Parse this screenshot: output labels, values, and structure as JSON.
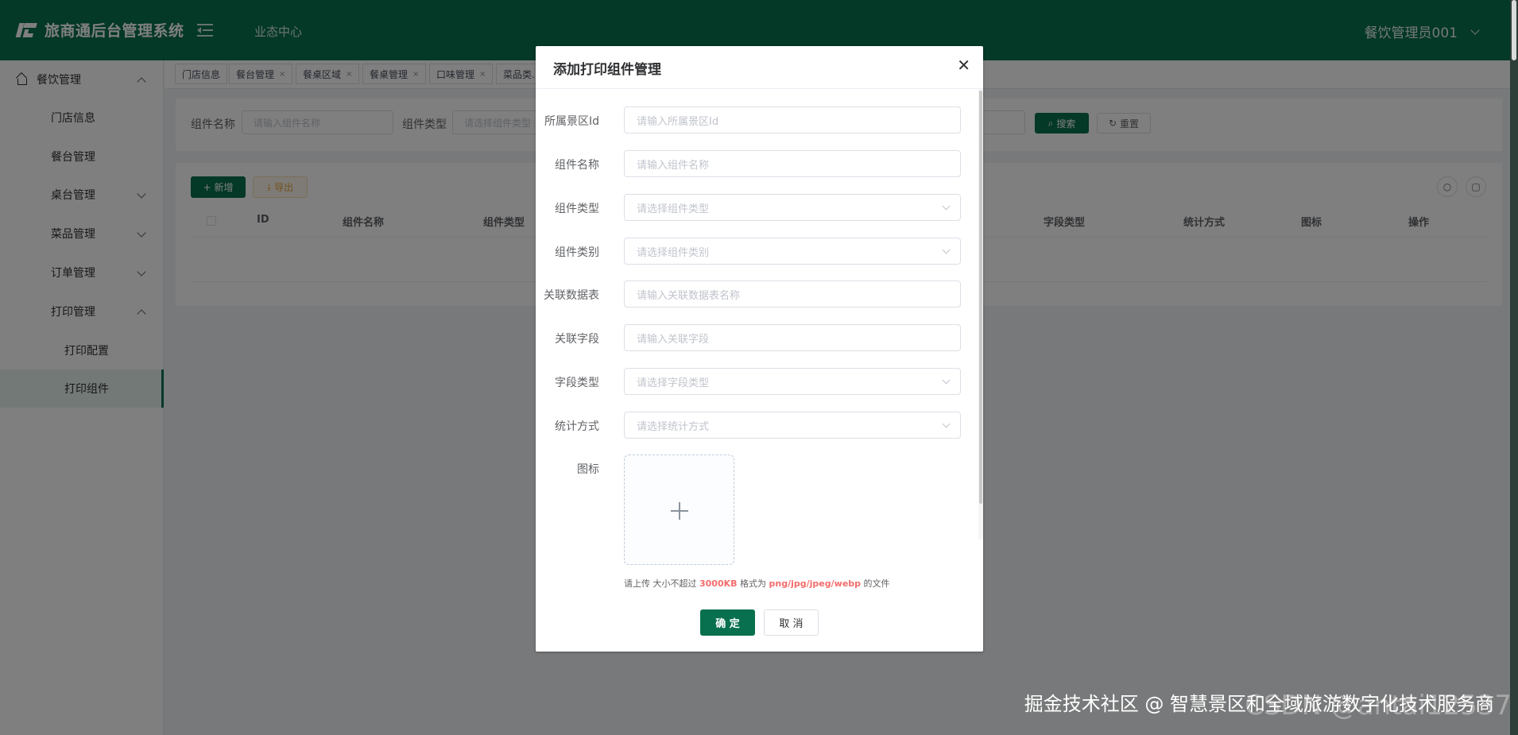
{
  "header": {
    "title": "旅商通后台管理系统",
    "nav": "业态中心",
    "user": "餐饮管理员001"
  },
  "sidebar": {
    "group": "餐饮管理",
    "items": [
      "门店信息",
      "餐台管理",
      "桌台管理",
      "菜品管理",
      "订单管理",
      "打印管理",
      "打印配置",
      "打印组件"
    ]
  },
  "tags": [
    "门店信息",
    "餐台管理",
    "餐桌区域",
    "餐桌管理",
    "口味管理",
    "菜品类..."
  ],
  "search": {
    "name_label": "组件名称",
    "name_placeholder": "请输入组件名称",
    "type_label": "组件类型",
    "type_placeholder": "请选择组件类型",
    "search_btn": "搜索",
    "reset_btn": "重置"
  },
  "toolbar": {
    "add": "新增",
    "export": "导出"
  },
  "table": {
    "columns": [
      "ID",
      "组件名称",
      "组件类型",
      "字段类型",
      "统计方式",
      "图标",
      "操作"
    ]
  },
  "dialog": {
    "title": "添加打印组件管理",
    "fields": [
      {
        "label": "所属景区Id",
        "placeholder": "请输入所属景区Id"
      },
      {
        "label": "组件名称",
        "placeholder": "请输入组件名称"
      },
      {
        "label": "组件类型",
        "placeholder": "请选择组件类型"
      },
      {
        "label": "组件类别",
        "placeholder": "请选择组件类别"
      },
      {
        "label": "关联数据表",
        "placeholder": "请输入关联数据表名称"
      },
      {
        "label": "关联字段",
        "placeholder": "请输入关联字段"
      },
      {
        "label": "字段类型",
        "placeholder": "请选择字段类型"
      },
      {
        "label": "统计方式",
        "placeholder": "请选择统计方式"
      }
    ],
    "icon_label": "图标",
    "tip": {
      "prefix": "请上传 大小不超过",
      "size": "3000KB",
      "mid": "格式为",
      "formats": "png/jpg/jpeg/webp",
      "suffix": "的文件"
    },
    "confirm": "确 定",
    "cancel": "取 消"
  },
  "watermark": {
    "main": "掘金技术社区 @ 智慧景区和全域旅游数字化技术服务商",
    "ghost": "CSDN @antai12537"
  }
}
